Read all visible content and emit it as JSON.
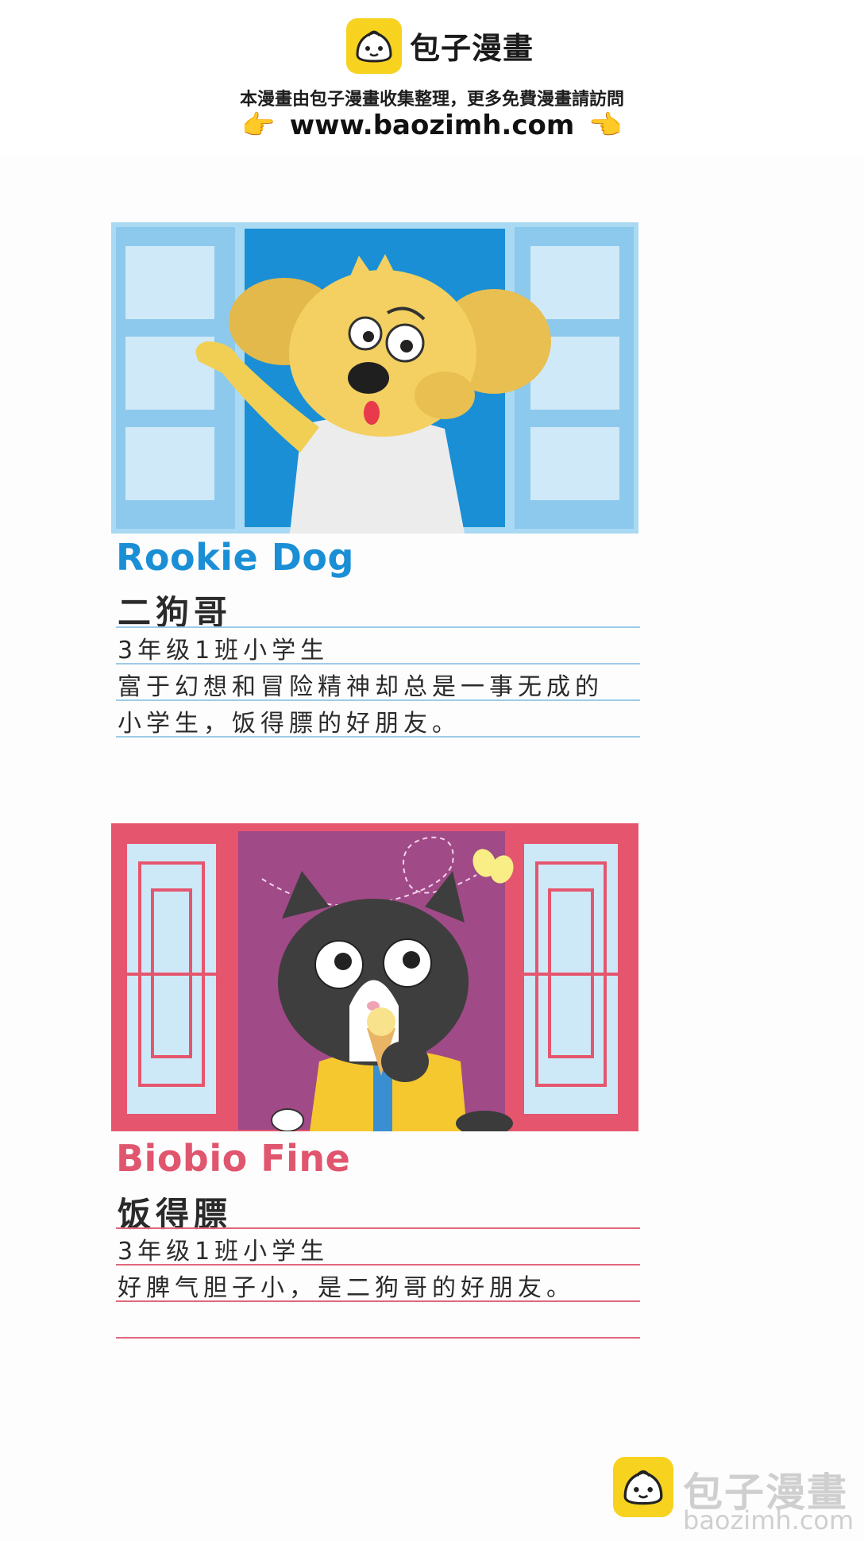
{
  "header": {
    "site_name": "包子漫畫",
    "notice": "本漫畫由包子漫畫收集整理，更多免費漫畫請訪問",
    "url": "www.baozimh.com",
    "pointer_icon": "pointing-hand-icon"
  },
  "colors": {
    "rookie_accent": "#1a8fd6",
    "biobio_accent": "#e0566e",
    "logo_yellow": "#f7d21f"
  },
  "characters": [
    {
      "name_en": "Rookie Dog",
      "name_zh": "二狗哥",
      "lines": [
        "3年级1班小学生",
        "富于幻想和冒险精神却总是一事无成的",
        "小学生，饭得膘的好朋友。"
      ]
    },
    {
      "name_en": "Biobio Fine",
      "name_zh": "饭得膘",
      "lines": [
        "3年级1班小学生",
        "好脾气胆子小，是二狗哥的好朋友。"
      ]
    }
  ],
  "watermark": {
    "name": "包子漫畫",
    "url": "baozimh.com"
  }
}
